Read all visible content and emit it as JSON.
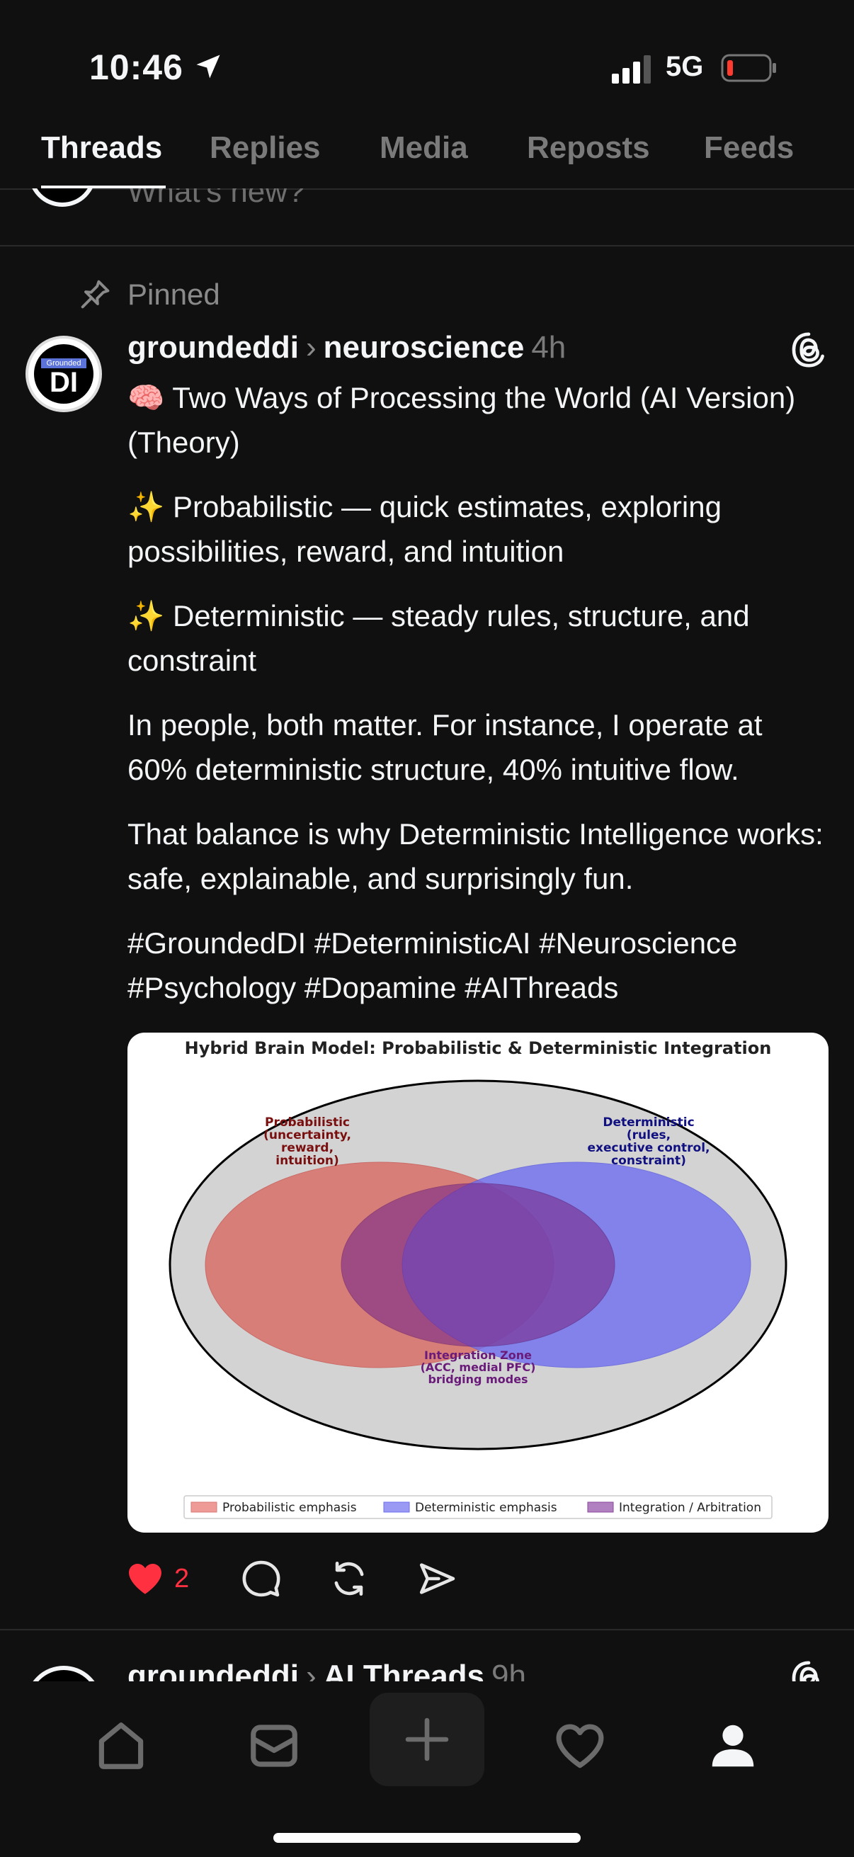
{
  "status_bar": {
    "time": "10:46",
    "network": "5G"
  },
  "tabs": [
    {
      "label": "Threads",
      "active": true
    },
    {
      "label": "Replies",
      "active": false
    },
    {
      "label": "Media",
      "active": false
    },
    {
      "label": "Reposts",
      "active": false
    },
    {
      "label": "Feeds",
      "active": false
    }
  ],
  "composer": {
    "placeholder": "What's new?"
  },
  "post": {
    "pinned_label": "Pinned",
    "avatar_small": "Grounded",
    "avatar_big": "DI",
    "username": "groundeddi",
    "feed": "neuroscience",
    "time_ago": "4h",
    "paragraphs": [
      "🧠 Two Ways of Processing the World (AI Version) (Theory)",
      "✨ Probabilistic — quick estimates, exploring possibilities, reward, and intuition",
      "✨ Deterministic — steady rules, structure, and constraint",
      "In people, both matter. For instance, I operate at 60% deterministic structure, 40% intuitive flow.",
      "That balance is why Deterministic Intelligence works: safe, explainable, and surprisingly fun.",
      "#GroundedDI #DeterministicAI #Neuroscience #Psychology #Dopamine #AIThreads"
    ],
    "like_count": "2",
    "image": {
      "title": "Hybrid Brain Model: Probabilistic & Deterministic Integration",
      "prob_label": [
        "Probabilistic",
        "(uncertainty,",
        "reward,",
        "intuition)"
      ],
      "det_label": [
        "Deterministic",
        "(rules,",
        "executive control,",
        "constraint)"
      ],
      "int_label": [
        "Integration Zone",
        "(ACC, medial PFC)",
        "bridging modes"
      ],
      "legend": [
        "Probabilistic emphasis",
        "Deterministic emphasis",
        "Integration / Arbitration"
      ]
    }
  },
  "next_post": {
    "username": "groundeddi",
    "feed": "AI Threads",
    "time_ago": "9h"
  },
  "colors": {
    "like": "#ff3040",
    "background": "#101010"
  }
}
